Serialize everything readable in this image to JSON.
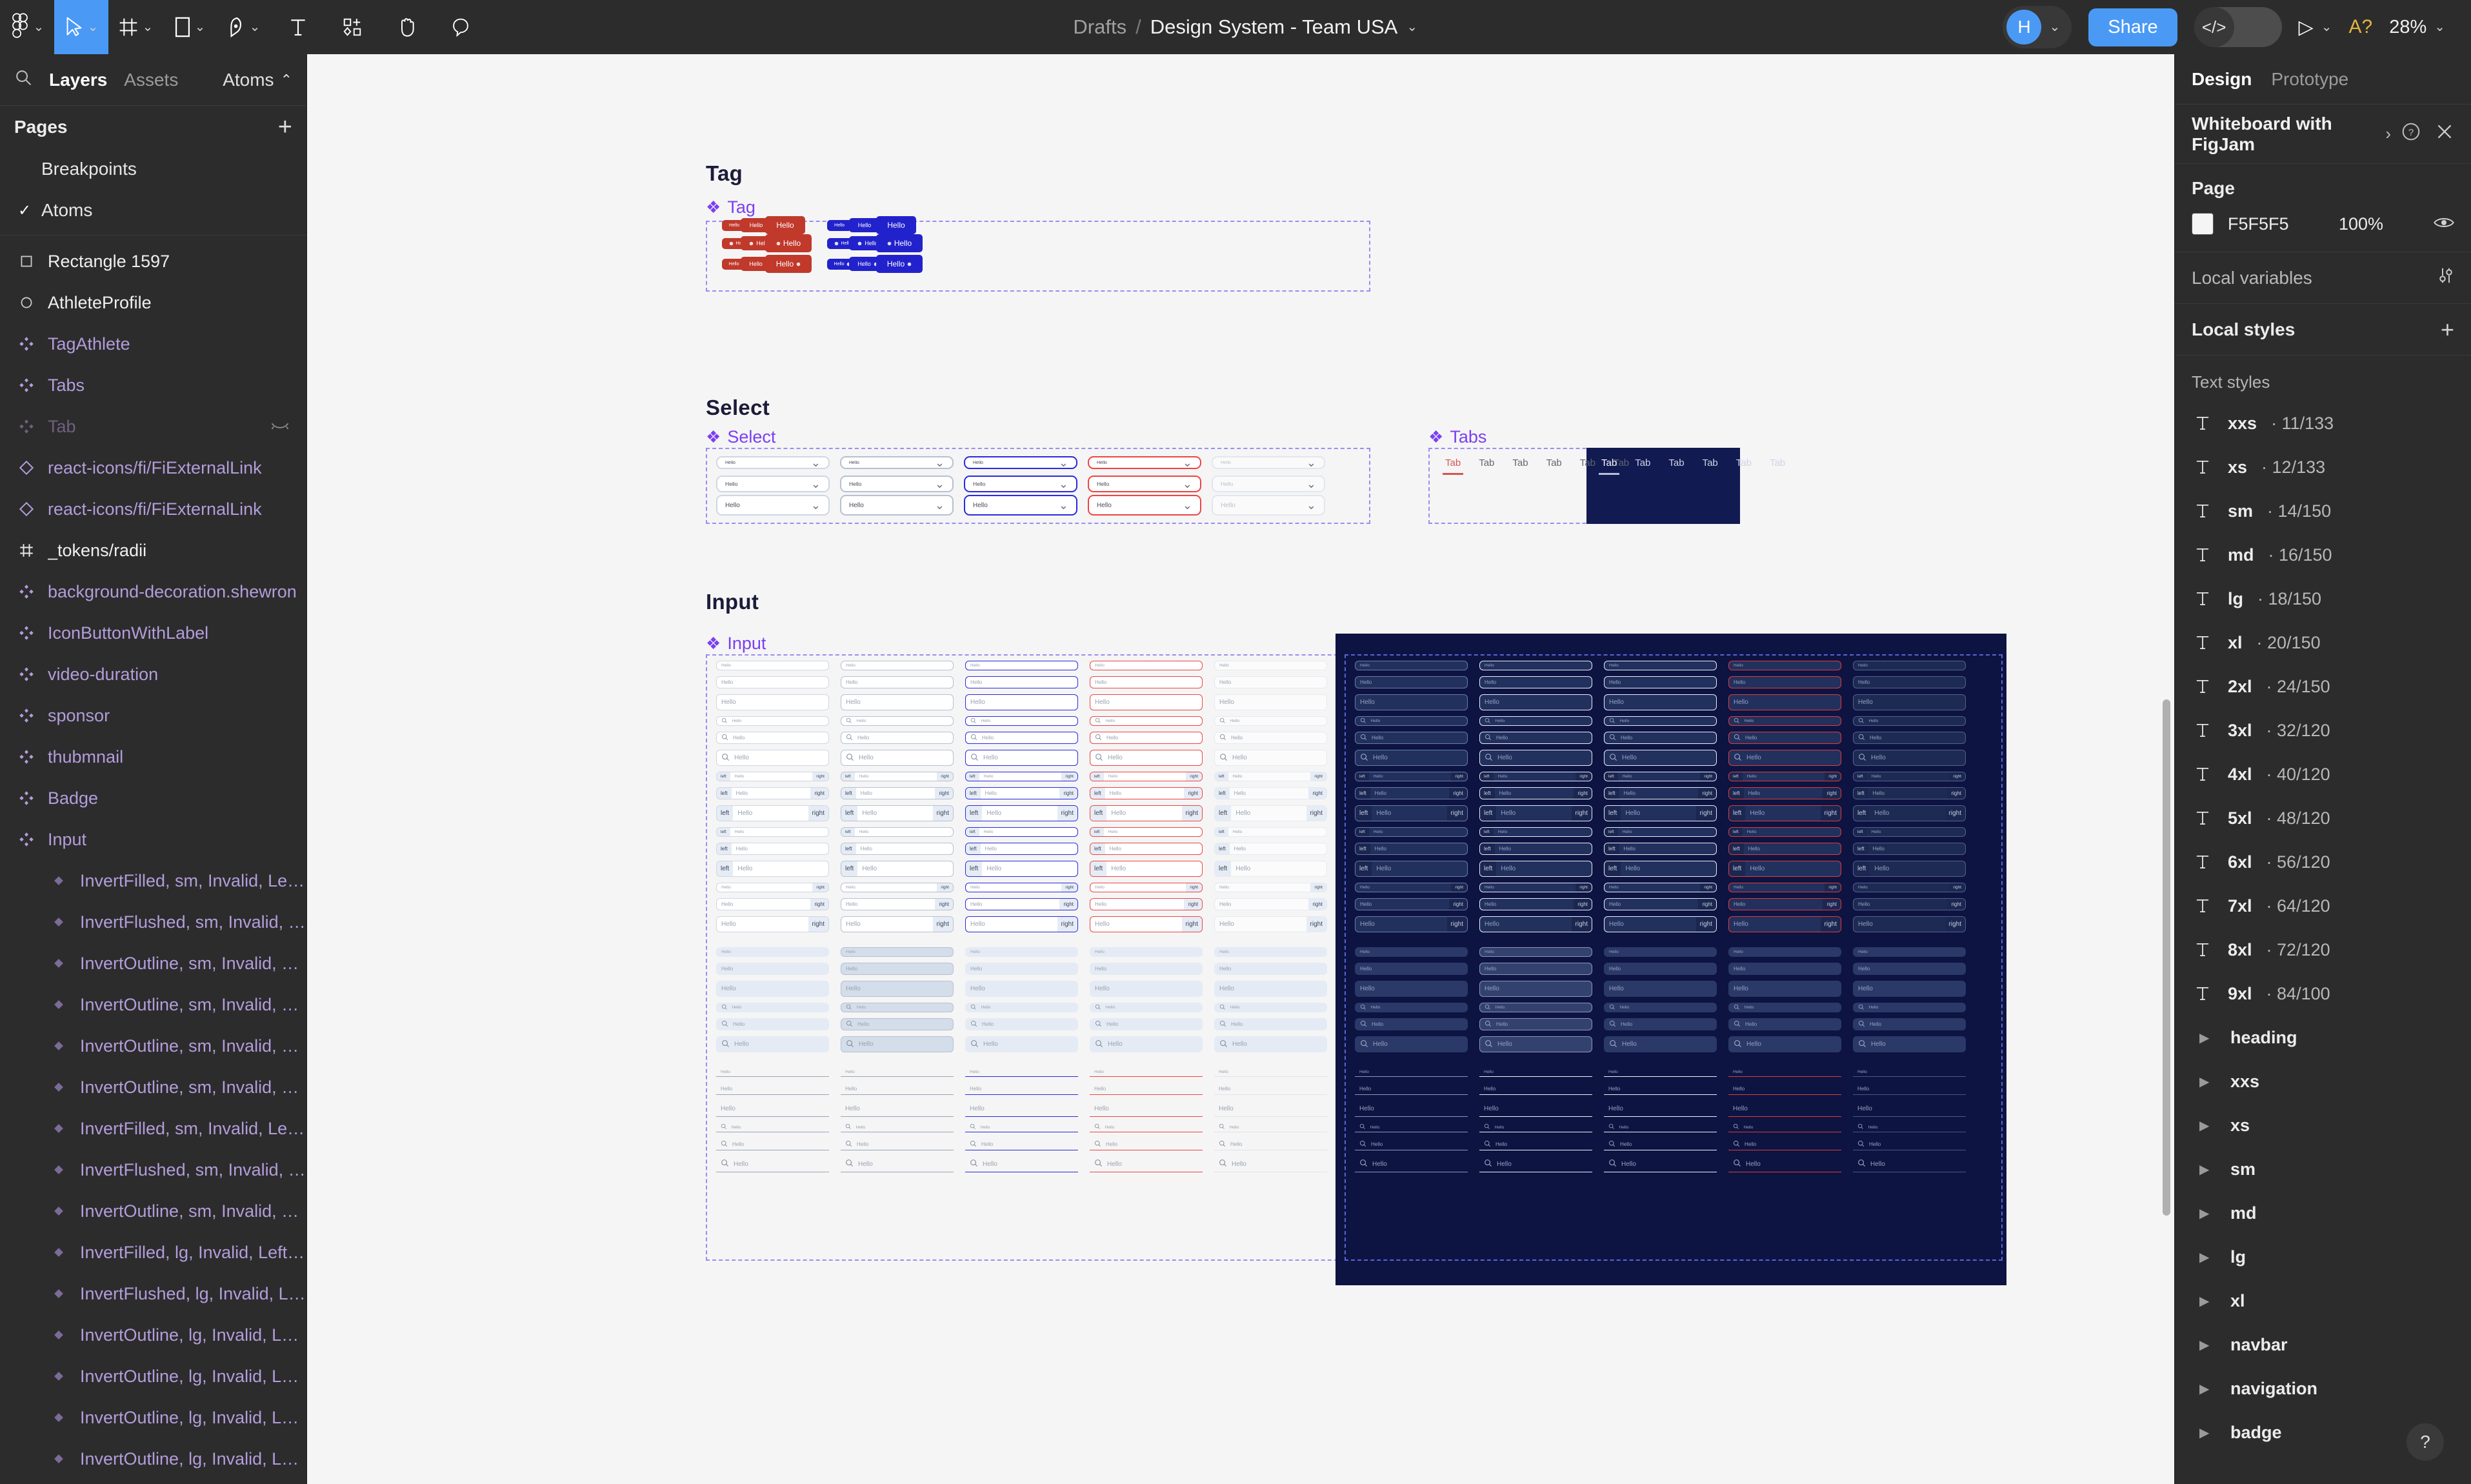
{
  "topbar": {
    "tools": [
      {
        "name": "figma-logo-icon",
        "caret": true
      },
      {
        "name": "move-tool-icon",
        "caret": true,
        "active": true
      },
      {
        "name": "frame-tool-icon",
        "caret": true
      },
      {
        "name": "shape-tool-icon",
        "caret": true
      },
      {
        "name": "pen-tool-icon",
        "caret": true
      },
      {
        "name": "text-tool-icon",
        "caret": false
      },
      {
        "name": "components-tool-icon",
        "caret": false
      },
      {
        "name": "hand-tool-icon",
        "caret": false
      },
      {
        "name": "comment-tool-icon",
        "caret": false
      }
    ],
    "breadcrumb_parent": "Drafts",
    "breadcrumb_separator": "/",
    "file_name": "Design System - Team USA",
    "avatar_initial": "H",
    "share_label": "Share",
    "devmode_label": "</>",
    "present_label": "▷",
    "alert_label": "A?",
    "zoom_level": "28%"
  },
  "left_panel": {
    "tabs": [
      {
        "label": "Layers",
        "active": true
      },
      {
        "label": "Assets",
        "active": false
      }
    ],
    "search_icon": "search-icon",
    "page_selector": "Atoms",
    "pages_header": "Pages",
    "add_page_label": "+",
    "pages": [
      {
        "label": "Breakpoints",
        "selected": false
      },
      {
        "label": "Atoms",
        "selected": true
      }
    ],
    "layers": [
      {
        "label": "Rectangle 1597",
        "icon": "rectangle-icon",
        "style": "white",
        "indent": false
      },
      {
        "label": "AthleteProfile",
        "icon": "ellipse-icon",
        "style": "white",
        "indent": false
      },
      {
        "label": "TagAthlete",
        "icon": "component-icon",
        "style": "component",
        "indent": false
      },
      {
        "label": "Tabs",
        "icon": "component-icon",
        "style": "component",
        "indent": false
      },
      {
        "label": "Tab",
        "icon": "component-icon",
        "style": "dim",
        "indent": false,
        "hidden": true
      },
      {
        "label": "react-icons/fi/FiExternalLink",
        "icon": "instance-icon",
        "style": "component",
        "indent": false
      },
      {
        "label": "react-icons/fi/FiExternalLink",
        "icon": "instance-icon",
        "style": "component",
        "indent": false
      },
      {
        "label": "_tokens/radii",
        "icon": "frame-icon",
        "style": "white",
        "indent": false
      },
      {
        "label": "background-decoration.shewron",
        "icon": "component-icon",
        "style": "component",
        "indent": false
      },
      {
        "label": "IconButtonWithLabel",
        "icon": "component-icon",
        "style": "component",
        "indent": false
      },
      {
        "label": "video-duration",
        "icon": "component-icon",
        "style": "component",
        "indent": false
      },
      {
        "label": "sponsor",
        "icon": "component-icon",
        "style": "component",
        "indent": false
      },
      {
        "label": "thubmnail",
        "icon": "component-icon",
        "style": "component",
        "indent": false
      },
      {
        "label": "Badge",
        "icon": "component-icon",
        "style": "component",
        "indent": false
      },
      {
        "label": "Input",
        "icon": "component-icon",
        "style": "component",
        "indent": false
      },
      {
        "label": "InvertFilled, sm, Invalid, Left ...",
        "icon": "variant-icon",
        "style": "instance",
        "indent": true
      },
      {
        "label": "InvertFlushed, sm, Invalid, Le...",
        "icon": "variant-icon",
        "style": "instance",
        "indent": true
      },
      {
        "label": "InvertOutline, sm, Invalid, Lef...",
        "icon": "variant-icon",
        "style": "instance",
        "indent": true
      },
      {
        "label": "InvertOutline, sm, Invalid, Lef...",
        "icon": "variant-icon",
        "style": "instance",
        "indent": true
      },
      {
        "label": "InvertOutline, sm, Invalid, Lef...",
        "icon": "variant-icon",
        "style": "instance",
        "indent": true
      },
      {
        "label": "InvertOutline, sm, Invalid, Lef...",
        "icon": "variant-icon",
        "style": "instance",
        "indent": true
      },
      {
        "label": "InvertFilled, sm, Invalid, Left ...",
        "icon": "variant-icon",
        "style": "instance",
        "indent": true
      },
      {
        "label": "InvertFlushed, sm, Invalid, Le...",
        "icon": "variant-icon",
        "style": "instance",
        "indent": true
      },
      {
        "label": "InvertOutline, sm, Invalid, Lef...",
        "icon": "variant-icon",
        "style": "instance",
        "indent": true
      },
      {
        "label": "InvertFilled, lg, Invalid, Left I...",
        "icon": "variant-icon",
        "style": "instance",
        "indent": true
      },
      {
        "label": "InvertFlushed, lg, Invalid, Lef...",
        "icon": "variant-icon",
        "style": "instance",
        "indent": true
      },
      {
        "label": "InvertOutline, lg, Invalid, Left ...",
        "icon": "variant-icon",
        "style": "instance",
        "indent": true
      },
      {
        "label": "InvertOutline, lg, Invalid, Left ...",
        "icon": "variant-icon",
        "style": "instance",
        "indent": true
      },
      {
        "label": "InvertOutline, lg, Invalid, Left ...",
        "icon": "variant-icon",
        "style": "instance",
        "indent": true
      },
      {
        "label": "InvertOutline, lg, Invalid, Left ...",
        "icon": "variant-icon",
        "style": "instance",
        "indent": true
      }
    ]
  },
  "canvas": {
    "sections": [
      {
        "title": "Tag",
        "frame_label": "Tag"
      },
      {
        "title": "Select",
        "frame_label": "Select"
      },
      {
        "title": "Input",
        "frame_label": "Input"
      }
    ],
    "tabs_frame_label": "Tabs",
    "tag_text": "Hello",
    "select_text": "Hello",
    "input_text": "Hello",
    "addon_left": "left",
    "addon_right": "right",
    "tab_label": "Tab",
    "tab_count": 6,
    "tag_colors": {
      "red": "#c0392b",
      "blue": "#2222cc"
    },
    "accent_purple": "#7b3ff2",
    "canvas_bg": "#F5F5F5",
    "dark_panel_bg": "#0d1442"
  },
  "right_panel": {
    "tabs": [
      {
        "label": "Design",
        "active": true
      },
      {
        "label": "Prototype",
        "active": false
      }
    ],
    "promo": {
      "title": "Whiteboard with FigJam",
      "arrow": "›",
      "help_icon": "help-circle-icon",
      "close_icon": "close-icon"
    },
    "page": {
      "title": "Page",
      "hex": "F5F5F5",
      "opacity": "100%",
      "visibility_icon": "eye-icon"
    },
    "local_variables": {
      "label": "Local variables",
      "icon": "variables-icon"
    },
    "local_styles": {
      "label": "Local styles",
      "add_icon": "plus-icon"
    },
    "text_styles_header": "Text styles",
    "text_styles": [
      {
        "name": "xxs",
        "detail": "· 11/133"
      },
      {
        "name": "xs",
        "detail": "· 12/133"
      },
      {
        "name": "sm",
        "detail": "· 14/150"
      },
      {
        "name": "md",
        "detail": "· 16/150"
      },
      {
        "name": "lg",
        "detail": "· 18/150"
      },
      {
        "name": "xl",
        "detail": "· 20/150"
      },
      {
        "name": "2xl",
        "detail": "· 24/150"
      },
      {
        "name": "3xl",
        "detail": "· 32/120"
      },
      {
        "name": "4xl",
        "detail": "· 40/120"
      },
      {
        "name": "5xl",
        "detail": "· 48/120"
      },
      {
        "name": "6xl",
        "detail": "· 56/120"
      },
      {
        "name": "7xl",
        "detail": "· 64/120"
      },
      {
        "name": "8xl",
        "detail": "· 72/120"
      },
      {
        "name": "9xl",
        "detail": "· 84/100"
      }
    ],
    "style_groups": [
      {
        "name": "heading"
      },
      {
        "name": "xxs"
      },
      {
        "name": "xs"
      },
      {
        "name": "sm"
      },
      {
        "name": "md"
      },
      {
        "name": "lg"
      },
      {
        "name": "xl"
      },
      {
        "name": "navbar"
      },
      {
        "name": "navigation"
      },
      {
        "name": "badge"
      }
    ],
    "help_fab": "?"
  }
}
